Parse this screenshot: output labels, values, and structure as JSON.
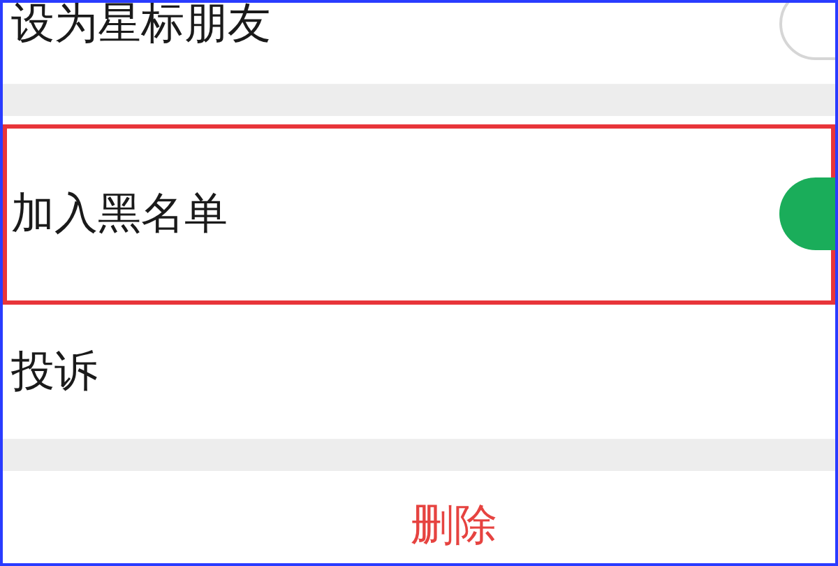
{
  "settings": [
    {
      "label": "设为星标朋友",
      "kind": "toggle",
      "on": false,
      "highlighted": false,
      "group_end": true
    },
    {
      "label": "加入黑名单",
      "kind": "toggle",
      "on": true,
      "highlighted": true,
      "group_end": false
    },
    {
      "label": "投诉",
      "kind": "plain",
      "highlighted": false,
      "group_end": true
    }
  ],
  "delete_button": "删除"
}
